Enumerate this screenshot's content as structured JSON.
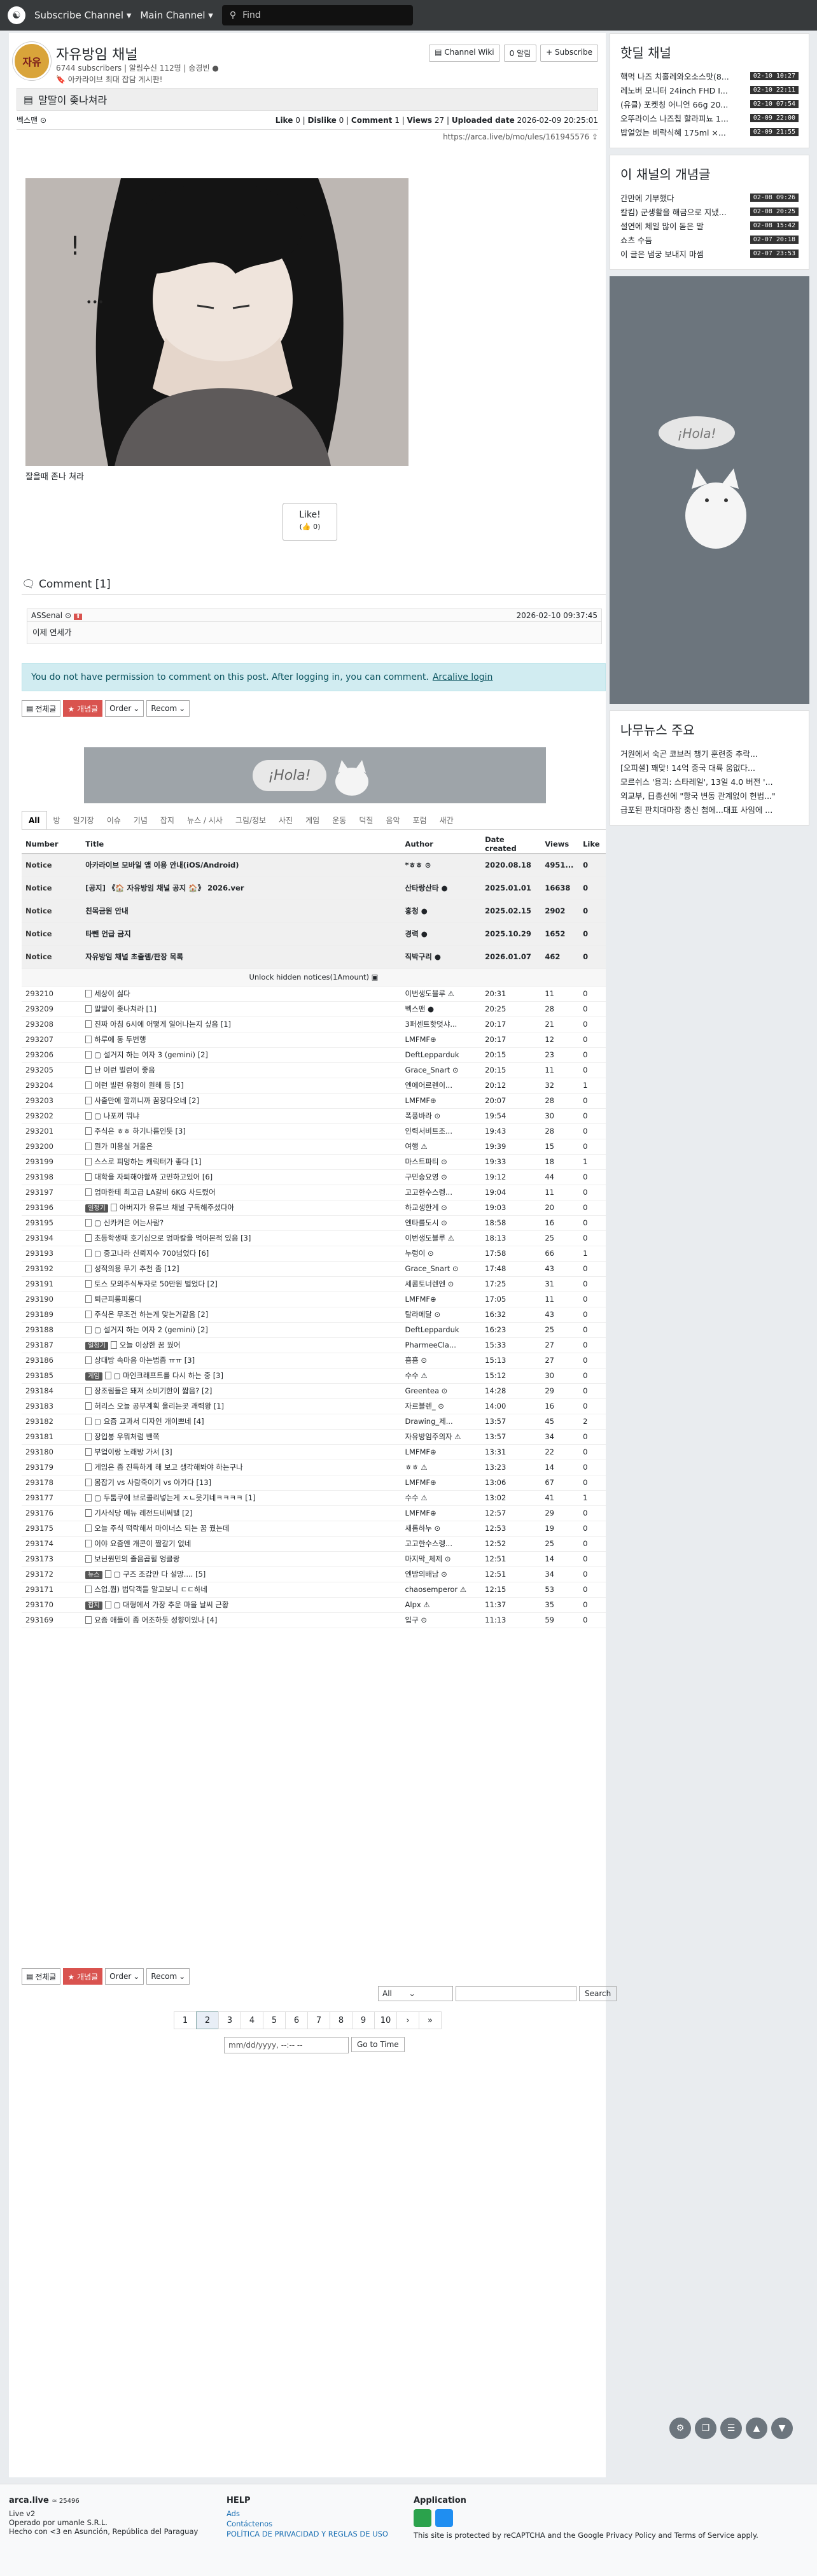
{
  "navbar": {
    "channel_menu": "Subscribe Channel ▾",
    "main_menu": "Main Channel ▾",
    "search_placeholder": "Find"
  },
  "channel": {
    "icon_text": "자유\n방임",
    "name": "자유방임 채널",
    "subs": "6744 subscribers | 알림수신 112명 | 송경빈 ●",
    "desc": "🔖 아카라이브 최대 잡담 게시판!",
    "wiki": "Channel Wiki",
    "alarm": "0 알림",
    "subscribe": "+ Subscribe"
  },
  "post": {
    "title": "말딸이 좆나쳐라",
    "author": "벡스맨",
    "like_label": "Like",
    "like": "0",
    "dislike_label": "Dislike",
    "dislike": "0",
    "comment_label": "Comment",
    "comment": "1",
    "views_label": "Views",
    "views": "27",
    "uploaded_label": "Uploaded date",
    "uploaded": "2026-02-09 20:25:01",
    "url": "https://arca.live/b/mo/ules/161945576 ⇪",
    "caption": "잘을때 존나 쳐라",
    "like_btn": "Like!",
    "like_count": "(👍 0)"
  },
  "comments": {
    "title": "Comment [1]",
    "items": [
      {
        "author": "ASSenal",
        "date": "2026-02-10 09:37:45",
        "text": "이제 연세가"
      }
    ],
    "notice": "You do not have permission to comment on this post. After logging in, you can comment.",
    "login_link": "Arcalive login"
  },
  "toolbar": {
    "all": "전체글",
    "best": "★ 개념글",
    "order": "Order",
    "recom": "Recom"
  },
  "categories": [
    "All",
    "방",
    "일기장",
    "이슈",
    "기념",
    "잡지",
    "뉴스 / 시사",
    "그림/정보",
    "사진",
    "게임",
    "운동",
    "덕질",
    "음악",
    "포럼",
    "새간"
  ],
  "table_headers": {
    "number": "Number",
    "title": "Title",
    "author": "Author",
    "date": "Date created",
    "views": "Views",
    "like": "Like"
  },
  "notices": [
    {
      "num": "Notice",
      "title": "아카라이브 모바일 앱 이용 안내(iOS/Android)",
      "author": "*ㅎㅎ ⊙",
      "date": "2020.08.18",
      "views": "4951...",
      "like": "0"
    },
    {
      "num": "Notice",
      "title": "[공지] 《🏠 자유방임 채널 공지 🏠》 2026.ver",
      "author": "산타랑산타 ●",
      "date": "2025.01.01",
      "views": "16638",
      "like": "0"
    },
    {
      "num": "Notice",
      "title": "친목금원 안내",
      "author": "홍청 ●",
      "date": "2025.02.15",
      "views": "2902",
      "like": "0"
    },
    {
      "num": "Notice",
      "title": "타뺀 언급 금지",
      "author": "경력 ●",
      "date": "2025.10.29",
      "views": "1652",
      "like": "0"
    },
    {
      "num": "Notice",
      "title": "자유방임 채널 초출렘/판장 목록",
      "author": "직박구리 ●",
      "date": "2026.01.07",
      "views": "462",
      "like": "0"
    }
  ],
  "unlock": "Unlock hidden notices(1Amount) ▣",
  "rows": [
    {
      "num": "293210",
      "tag": "",
      "title": "세상이 싫다",
      "author": "이번생도블루 ⚠",
      "date": "20:31",
      "views": "11",
      "like": "0"
    },
    {
      "num": "293209",
      "tag": "",
      "title": "말딸이 좆나쳐라 [1]",
      "author": "벡스맨 ●",
      "date": "20:25",
      "views": "28",
      "like": "0"
    },
    {
      "num": "293208",
      "tag": "",
      "title": "진짜 아침 6시에 어떻게 일어나는지 싶음 [1]",
      "author": "3퍼센트핫덧샤...",
      "date": "20:17",
      "views": "21",
      "like": "0"
    },
    {
      "num": "293207",
      "tag": "",
      "title": "하루에 동 두번행",
      "author": "LMFMF⊕",
      "date": "20:17",
      "views": "12",
      "like": "0"
    },
    {
      "num": "293206",
      "tag": "",
      "title": "▢ 설거지 하는 여자 3 (gemini) [2]",
      "author": "DeftLepparduk",
      "date": "20:15",
      "views": "23",
      "like": "0"
    },
    {
      "num": "293205",
      "tag": "",
      "title": "난 이런 빌런이 좋음",
      "author": "Grace_Snart ⊙",
      "date": "20:15",
      "views": "11",
      "like": "0"
    },
    {
      "num": "293204",
      "tag": "",
      "title": "이런 빌런 유형이 원해 등 [5]",
      "author": "엔에어르렌이...",
      "date": "20:12",
      "views": "32",
      "like": "1"
    },
    {
      "num": "293203",
      "tag": "",
      "title": "사출만에 깔끼니까 꿈장다오네 [2]",
      "author": "LMFMF⊕",
      "date": "20:07",
      "views": "28",
      "like": "0"
    },
    {
      "num": "293202",
      "tag": "",
      "title": "▢ 나포끼 뭐냐",
      "author": "폭풍바라 ⊙",
      "date": "19:54",
      "views": "30",
      "like": "0"
    },
    {
      "num": "293201",
      "tag": "",
      "title": "주식은 ㅎㅎ 하기나름인듯 [3]",
      "author": "인력서비트조...",
      "date": "19:43",
      "views": "28",
      "like": "0"
    },
    {
      "num": "293200",
      "tag": "",
      "title": "뭔가 미용실 거울은",
      "author": "여행 ⚠",
      "date": "19:39",
      "views": "15",
      "like": "0"
    },
    {
      "num": "293199",
      "tag": "",
      "title": "스스로 피멍하는 캐릭터가 좋다 [1]",
      "author": "마스트파티 ⊙",
      "date": "19:33",
      "views": "18",
      "like": "1"
    },
    {
      "num": "293198",
      "tag": "",
      "title": "대학을 자퇴해야할까 고민하고있어 [6]",
      "author": "구민승요영 ⊙",
      "date": "19:12",
      "views": "44",
      "like": "0"
    },
    {
      "num": "293197",
      "tag": "",
      "title": "엄마한테 최고급 LA갈비 6KG 사드렸어",
      "author": "고고한수스렝...",
      "date": "19:04",
      "views": "11",
      "like": "0"
    },
    {
      "num": "293196",
      "tag": "일정기",
      "title": "아버지가 유튜브 채널 구독해주셨다아",
      "author": "하교생한게 ⊙",
      "date": "19:03",
      "views": "20",
      "like": "0"
    },
    {
      "num": "293195",
      "tag": "",
      "title": "▢ 신카커은 어는사람?",
      "author": "엔타를도시 ⊙",
      "date": "18:58",
      "views": "16",
      "like": "0"
    },
    {
      "num": "293194",
      "tag": "",
      "title": "초등학생때 호기심으로 엄마칼을 먹어본적 있음 [3]",
      "author": "이번생도블루 ⚠",
      "date": "18:13",
      "views": "25",
      "like": "0"
    },
    {
      "num": "293193",
      "tag": "",
      "title": "▢ 중고나라 신뢰지수 700넘었다 [6]",
      "author": "누렁이 ⊙",
      "date": "17:58",
      "views": "66",
      "like": "1"
    },
    {
      "num": "293192",
      "tag": "",
      "title": "성적의용 무기 추천 좀 [12]",
      "author": "Grace_Snart ⊙",
      "date": "17:48",
      "views": "43",
      "like": "0"
    },
    {
      "num": "293191",
      "tag": "",
      "title": "토스 모의주식투자로 50만원 벌었다 [2]",
      "author": "세콤토너렌엔 ⊙",
      "date": "17:25",
      "views": "31",
      "like": "0"
    },
    {
      "num": "293190",
      "tag": "",
      "title": "퇴근피롱피롱디",
      "author": "LMFMF⊕",
      "date": "17:05",
      "views": "11",
      "like": "0"
    },
    {
      "num": "293189",
      "tag": "",
      "title": "주식은 무조건 하는게 맞는거같음 [2]",
      "author": "탈라메달 ⊙",
      "date": "16:32",
      "views": "43",
      "like": "0"
    },
    {
      "num": "293188",
      "tag": "",
      "title": "▢ 설거지 하는 여자 2 (gemini) [2]",
      "author": "DeftLepparduk",
      "date": "16:23",
      "views": "25",
      "like": "0"
    },
    {
      "num": "293187",
      "tag": "일정기",
      "title": "오늘 이상한 꿈 꿨어",
      "author": "PharmeeCla...",
      "date": "15:33",
      "views": "27",
      "like": "0"
    },
    {
      "num": "293186",
      "tag": "",
      "title": "상대방 속마음 아는법좀 ㅠㅠ [3]",
      "author": "흠흠 ⊙",
      "date": "15:13",
      "views": "27",
      "like": "0"
    },
    {
      "num": "293185",
      "tag": "게임",
      "title": "▢ 마인크래프트를 다시 하는 중 [3]",
      "author": "수수 ⚠",
      "date": "15:12",
      "views": "30",
      "like": "0"
    },
    {
      "num": "293184",
      "tag": "",
      "title": "장조림들은 돼져 소비기한이 짧음? [2]",
      "author": "Greentea ⊙",
      "date": "14:28",
      "views": "29",
      "like": "0"
    },
    {
      "num": "293183",
      "tag": "",
      "title": "허리스 오늘 공부계획 올리는곳 괘력왕 [1]",
      "author": "자르블렌_ ⊙",
      "date": "14:00",
      "views": "16",
      "like": "0"
    },
    {
      "num": "293182",
      "tag": "",
      "title": "▢ 요즘 교과서 디자인 개이쁘네 [4]",
      "author": "Drawing_제...",
      "date": "13:57",
      "views": "45",
      "like": "2"
    },
    {
      "num": "293181",
      "tag": "",
      "title": "장입봉 우뭐처럼 밴쪽",
      "author": "자유방임주의자 ⚠",
      "date": "13:57",
      "views": "34",
      "like": "0"
    },
    {
      "num": "293180",
      "tag": "",
      "title": "부업이랑 노래방 가서 [3]",
      "author": "LMFMF⊕",
      "date": "13:31",
      "views": "22",
      "like": "0"
    },
    {
      "num": "293179",
      "tag": "",
      "title": "게임은 좀 진득하게 해 보고 생각해봐야 하는구나",
      "author": "ㅎㅎ ⚠",
      "date": "13:23",
      "views": "14",
      "like": "0"
    },
    {
      "num": "293178",
      "tag": "",
      "title": "몸잡기 vs 사람죽이기 vs 아가다 [13]",
      "author": "LMFMF⊕",
      "date": "13:06",
      "views": "67",
      "like": "0"
    },
    {
      "num": "293177",
      "tag": "",
      "title": "▢ 두툼쿠에 브로콜리넣는게 ㅈㄴ웃기네ㅋㅋㅋㅋ [1]",
      "author": "수수 ⚠",
      "date": "13:02",
      "views": "41",
      "like": "1"
    },
    {
      "num": "293176",
      "tag": "",
      "title": "기사식당 메뉴 레전드네써밸 [2]",
      "author": "LMFMF⊕",
      "date": "12:57",
      "views": "29",
      "like": "0"
    },
    {
      "num": "293175",
      "tag": "",
      "title": "오늘 주식 떡락해서 마이너스 되는 꿈 꿨는데",
      "author": "새롭하누 ⊙",
      "date": "12:53",
      "views": "19",
      "like": "0"
    },
    {
      "num": "293174",
      "tag": "",
      "title": "이야 요즘엔 개콘이 짤갈기 없네",
      "author": "고고한수스렝...",
      "date": "12:52",
      "views": "25",
      "like": "0"
    },
    {
      "num": "293173",
      "tag": "",
      "title": "보닌뭔민의 졸음곱힐 엉클랑",
      "author": "마지막_체제 ⊙",
      "date": "12:51",
      "views": "14",
      "like": "0"
    },
    {
      "num": "293172",
      "tag": "뉴스",
      "title": "▢ 구즈 조갑만 다 설망.... [5]",
      "author": "엔밤의배남 ⊙",
      "date": "12:51",
      "views": "34",
      "like": "0"
    },
    {
      "num": "293171",
      "tag": "",
      "title": "스업.뭡) 법닥객들 알고보니 ㄷㄷ하네",
      "author": "chaosemperor ⚠",
      "date": "12:15",
      "views": "53",
      "like": "0"
    },
    {
      "num": "293170",
      "tag": "잡지",
      "title": "▢ 대형에서 가장 추운 마을 날씨 근황",
      "author": "Alpx ⚠",
      "date": "11:37",
      "views": "35",
      "like": "0"
    },
    {
      "num": "293169",
      "tag": "",
      "title": "요즘 애들이 좀 어조하듯 성향이있나 [4]",
      "author": "입구 ⊙",
      "date": "11:13",
      "views": "59",
      "like": "0"
    }
  ],
  "search": {
    "scope": "All",
    "button": "Search"
  },
  "pagination": [
    "1",
    "2",
    "3",
    "4",
    "5",
    "6",
    "7",
    "8",
    "9",
    "10"
  ],
  "current_page": "2",
  "date_search": {
    "placeholder": "mm/dd/yyyy, --:-- --",
    "button": "Go to Time"
  },
  "sidebar": {
    "hot_title": "핫딜 채널",
    "hot": [
      {
        "t": "핵먹 나즈 치홀레와오소스맛(8...",
        "time": "02-10 10:27"
      },
      {
        "t": "레노버 모니터 24inch FHD I...",
        "time": "02-10 22:11"
      },
      {
        "t": "(유클) 포켓칭 어니언 66g 20...",
        "time": "02-10 07:54"
      },
      {
        "t": "오뚜라이스 나즈칩 할라피뇨 1...",
        "time": "02-09 22:00"
      },
      {
        "t": "밥얼었는 비락식혜 175ml ×...",
        "time": "02-09 21:55"
      }
    ],
    "concept_title": "이 채널의 개념글",
    "concept": [
      {
        "t": "간만에 기부했다",
        "time": "02-08 09:26"
      },
      {
        "t": "칼킴) 군생활을 해금으로 지냈...",
        "time": "02-08 20:25"
      },
      {
        "t": "설연에 체일 많이 돋은 말",
        "time": "02-08 15:42"
      },
      {
        "t": "쇼츠 수듬",
        "time": "02-07 20:18"
      },
      {
        "t": "이 글은 냄궁 보내지 마셈",
        "time": "02-07 23:53"
      }
    ],
    "news_title": "나무뉴스 주요",
    "news": [
      "거원에서 숙곤 코브러 챙기 훈련중 추락...",
      "[오피셜] 꽤맞! 14억 중국 대륙 움없다...",
      "모르쉬스 '용괴: 스타레일', 13일 4.0 버전 '...",
      "외교부, 日총선에 \"항국 변동 관계없이 헌법...\"",
      "급포된 판치대마장 충신 첨에...대표 사임에 ..."
    ],
    "ad_hola": "¡Hola!"
  },
  "footer": {
    "brand": "arca.live",
    "count": "≈ 25496",
    "ver": "Live v2",
    "op": "Operado por umanle S.R.L.",
    "made": "Hecho con <3 en Asunción, República del Paraguay",
    "help_title": "HELP",
    "help_links": [
      "Ads",
      "Contáctenos",
      "POLÍTICA DE PRIVACIDAD Y REGLAS DE USO"
    ],
    "app_title": "Application",
    "recaptcha": "This site is protected by reCAPTCHA and the Google Privacy Policy and Terms of Service apply."
  }
}
